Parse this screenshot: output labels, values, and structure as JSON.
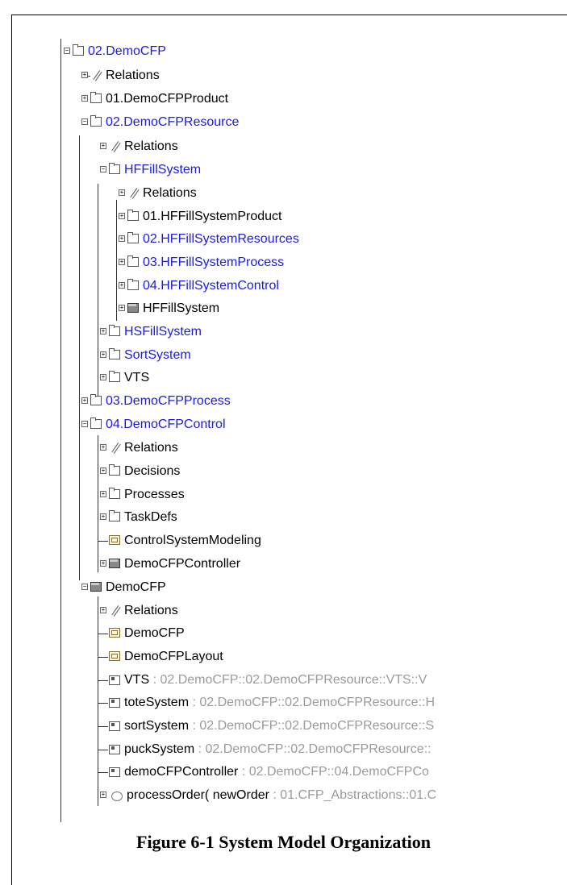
{
  "tree": {
    "root": "02.DemoCFP",
    "rows": [
      {
        "label": "Relations"
      },
      {
        "label": "01.DemoCFPProduct"
      },
      {
        "label": "02.DemoCFPResource"
      },
      {
        "label": "Relations"
      },
      {
        "label": "HFFillSystem"
      },
      {
        "label": "Relations"
      },
      {
        "label": "01.HFFillSystemProduct"
      },
      {
        "label": "02.HFFillSystemResources"
      },
      {
        "label": "03.HFFillSystemProcess"
      },
      {
        "label": "04.HFFillSystemControl"
      },
      {
        "label": "HFFillSystem"
      },
      {
        "label": "HSFillSystem"
      },
      {
        "label": "SortSystem"
      },
      {
        "label": "VTS"
      },
      {
        "label": "03.DemoCFPProcess"
      },
      {
        "label": "04.DemoCFPControl"
      },
      {
        "label": "Relations"
      },
      {
        "label": "Decisions"
      },
      {
        "label": "Processes"
      },
      {
        "label": "TaskDefs"
      },
      {
        "label": "ControlSystemModeling"
      },
      {
        "label": "DemoCFPController"
      },
      {
        "label": "DemoCFP"
      },
      {
        "label": "Relations"
      },
      {
        "label": "DemoCFP"
      },
      {
        "label": "DemoCFPLayout"
      },
      {
        "label": "VTS",
        "type": " : 02.DemoCFP::02.DemoCFPResource::VTS::V"
      },
      {
        "label": "toteSystem",
        "type": " : 02.DemoCFP::02.DemoCFPResource::H"
      },
      {
        "label": "sortSystem",
        "type": " : 02.DemoCFP::02.DemoCFPResource::S"
      },
      {
        "label": "puckSystem",
        "type": " : 02.DemoCFP::02.DemoCFPResource::"
      },
      {
        "label": "demoCFPController",
        "type": " : 02.DemoCFP::04.DemoCFPCo"
      },
      {
        "label": "processOrder( newOrder",
        "type": " : 01.CFP_Abstractions::01.C"
      }
    ]
  },
  "caption": "Figure 6-1 System Model Organization",
  "colors": {
    "package_blue": "#1a1ae6",
    "type_grey": "#9a9a9a"
  }
}
